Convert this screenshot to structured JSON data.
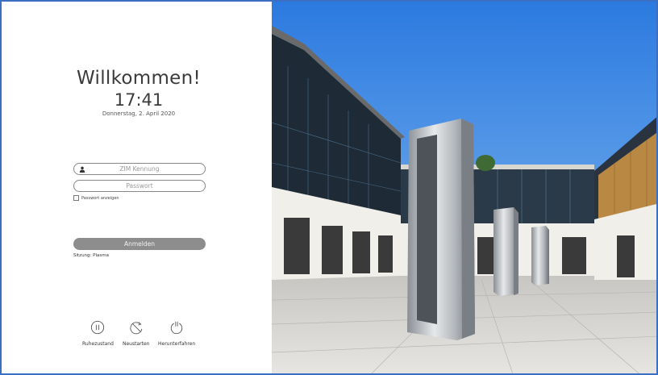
{
  "greeting": "Willkommen!",
  "time": "17:41",
  "date": "Donnerstag, 2. April 2020",
  "username": {
    "placeholder": "ZIM Kennung",
    "icon": "user-icon"
  },
  "password": {
    "placeholder": "Passwort"
  },
  "show_password_label": "Passwort anzeigen",
  "login_label": "Anmelden",
  "session_label": "Sitzung: Plasma",
  "power_actions": [
    {
      "label": "Ruhezustand",
      "icon": "suspend-icon"
    },
    {
      "label": "Neustarten",
      "icon": "restart-icon"
    },
    {
      "label": "Herunterfahren",
      "icon": "shutdown-icon"
    }
  ],
  "colors": {
    "frame": "#3a6fc4",
    "login_button": "#8d8d8d",
    "sky": "#2f7fe0"
  }
}
